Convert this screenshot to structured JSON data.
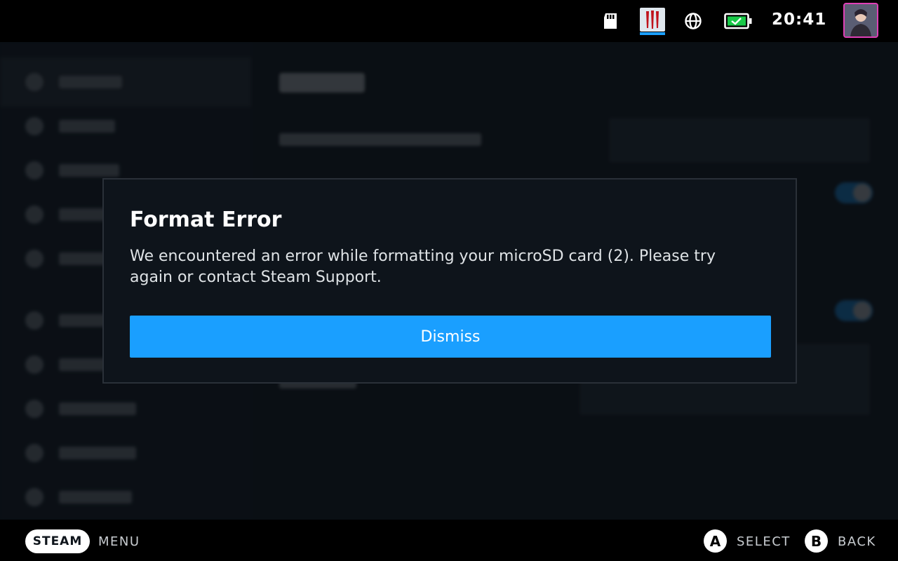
{
  "status_bar": {
    "clock": "20:41",
    "icons": [
      "sd-card-icon",
      "game-icon",
      "globe-icon",
      "battery-charging-icon",
      "avatar"
    ],
    "battery_color": "#19c948",
    "game_indicator_color": "#1a9fff",
    "avatar_border_color": "#e03fb6"
  },
  "modal": {
    "title": "Format Error",
    "message": "We encountered an error while formatting your microSD card (2). Please try again or contact Steam Support.",
    "dismiss_label": "Dismiss",
    "accent_color": "#1a9fff"
  },
  "footer": {
    "steam_label": "STEAM",
    "menu_label": "MENU",
    "a_glyph": "A",
    "select_label": "SELECT",
    "b_glyph": "B",
    "back_label": "BACK"
  }
}
